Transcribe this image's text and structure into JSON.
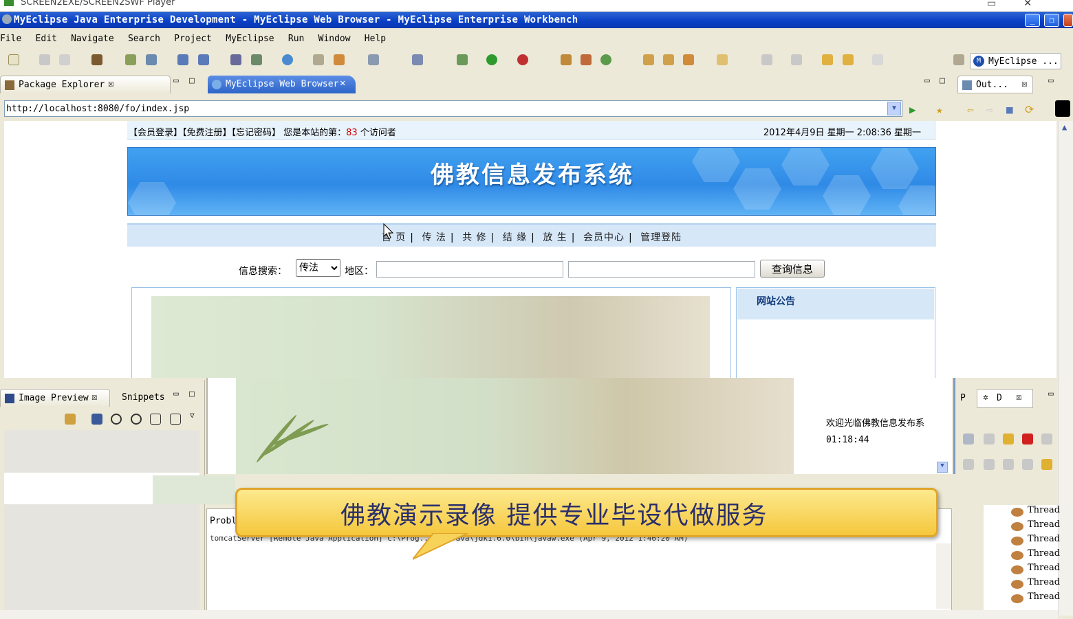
{
  "player": {
    "title": "SCREEN2EXE/SCREEN2SWF Player"
  },
  "window": {
    "title": "MyEclipse Java Enterprise Development - MyEclipse Web Browser - MyEclipse Enterprise Workbench"
  },
  "menu": [
    "File",
    "Edit",
    "Navigate",
    "Search",
    "Project",
    "MyEclipse",
    "Run",
    "Window",
    "Help"
  ],
  "perspective": {
    "label": "MyEclipse ..."
  },
  "tabs": {
    "package_explorer": "Package Explorer",
    "web_browser": "MyEclipse Web Browser",
    "outline": "Out..."
  },
  "browser": {
    "url": "http://localhost:8080/fo/index.jsp"
  },
  "site": {
    "top_links": "【会员登录】【免费注册】【忘记密码】 您是本站的第：",
    "visitor_count": "83",
    "visitor_suffix": " 个访问者",
    "datetime": "2012年4月9日 星期一 2:08:36   星期一",
    "banner_title": "佛教信息发布系统",
    "nav": [
      "首 页",
      "传 法",
      "共 修",
      "结 缘",
      "放 生",
      "会员中心",
      "管理登陆"
    ],
    "search_label": "信息搜索：",
    "search_type": "传法",
    "region_label": "地区：",
    "search_button": "查询信息",
    "notice_title": "网站公告",
    "welcome_text": "欢迎光临佛教信息发布系",
    "welcome_time": "01:18:44"
  },
  "views": {
    "image_preview": "Image Preview",
    "snippets": "Snippets",
    "debug_p": "P",
    "debug_d": "D"
  },
  "console": {
    "tab": "Probl",
    "line": "tomcatServer [Remote Java Application] C:\\Prog...les\\Java\\jdk1.6.0\\bin\\javaw.exe (Apr 9, 2012 1:46:20 AM)"
  },
  "threads": [
    "Thread",
    "Thread",
    "Thread",
    "Thread",
    "Thread",
    "Thread",
    "Thread"
  ],
  "overlay": {
    "text": "佛教演示录像 提供专业毕设代做服务"
  }
}
